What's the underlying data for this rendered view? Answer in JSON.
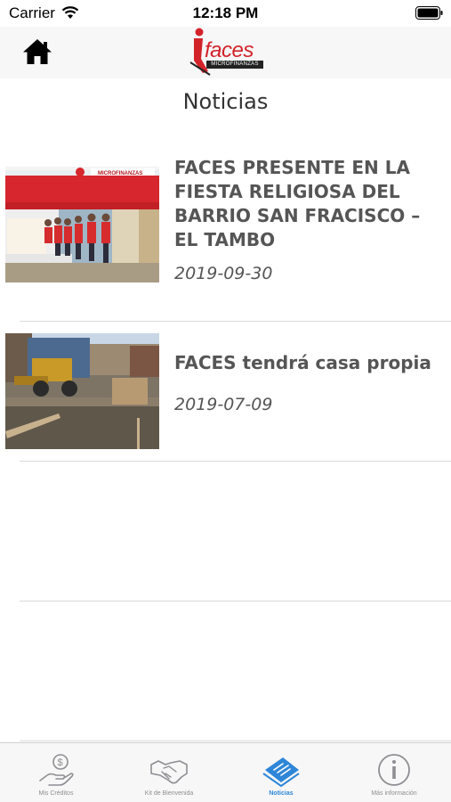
{
  "status_bar": {
    "carrier": "Carrier",
    "time": "12:18 PM"
  },
  "nav": {
    "logo_text": "faces",
    "logo_subtitle": "MICROFINANZAS"
  },
  "page": {
    "title": "Noticias"
  },
  "news": [
    {
      "title": "FACES PRESENTE EN LA FIESTA RELIGIOSA DEL BARRIO SAN FRACISCO – EL TAMBO",
      "date": "2019-09-30",
      "image_caption": "MICROFINANZAS"
    },
    {
      "title": "FACES tendrá casa propia",
      "date": "2019-07-09"
    }
  ],
  "tabs": [
    {
      "label": "Mis Créditos",
      "icon": "money-hand-icon",
      "active": false
    },
    {
      "label": "Kit de Bienvenida",
      "icon": "handshake-icon",
      "active": false
    },
    {
      "label": "Noticias",
      "icon": "newspaper-icon",
      "active": true
    },
    {
      "label": "Más información",
      "icon": "info-icon",
      "active": false
    }
  ],
  "colors": {
    "brand_red": "#d2232a",
    "accent_blue": "#2f86d8",
    "tab_gray": "#8e8e93"
  }
}
